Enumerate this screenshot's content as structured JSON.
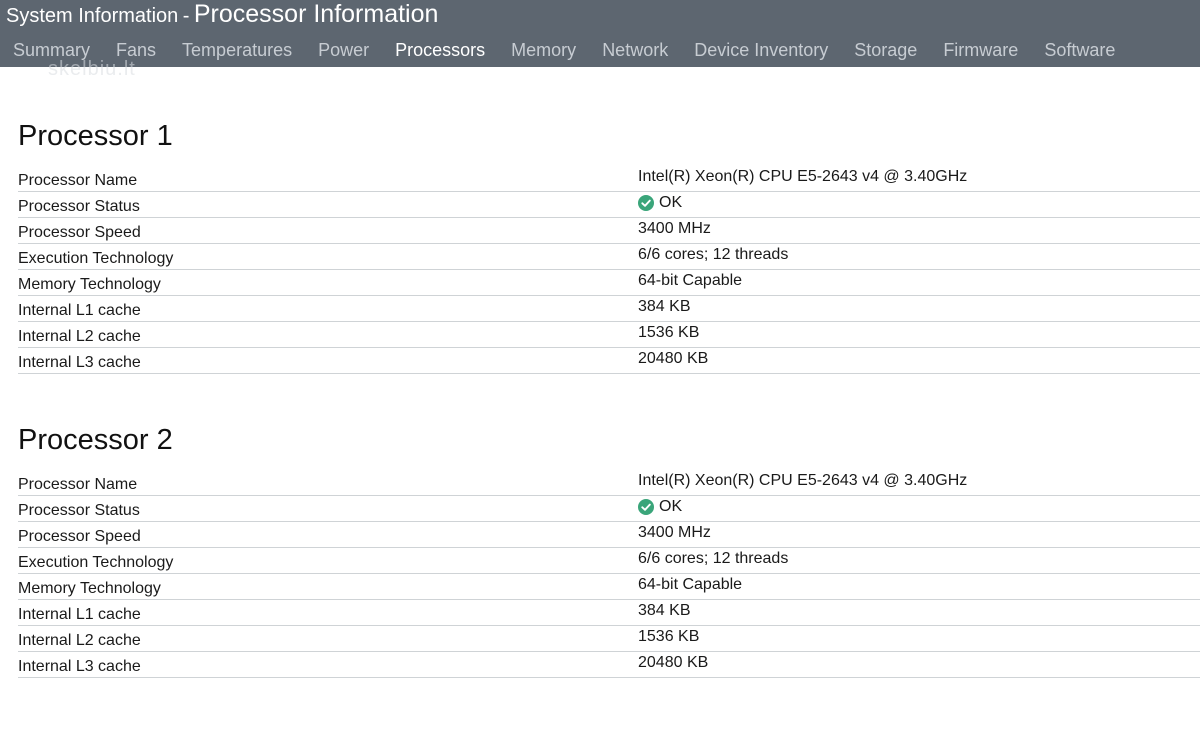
{
  "header": {
    "title_prefix": "System Information",
    "title_separator": "-",
    "title_main": "Processor Information",
    "tabs": [
      {
        "label": "Summary",
        "active": false
      },
      {
        "label": "Fans",
        "active": false
      },
      {
        "label": "Temperatures",
        "active": false
      },
      {
        "label": "Power",
        "active": false
      },
      {
        "label": "Processors",
        "active": true
      },
      {
        "label": "Memory",
        "active": false
      },
      {
        "label": "Network",
        "active": false
      },
      {
        "label": "Device Inventory",
        "active": false
      },
      {
        "label": "Storage",
        "active": false
      },
      {
        "label": "Firmware",
        "active": false
      },
      {
        "label": "Software",
        "active": false
      }
    ],
    "watermark": "skelbiu.lt"
  },
  "colors": {
    "header_bg": "#5d6670",
    "tab_inactive": "#c7ccd2",
    "tab_active": "#ffffff",
    "ok_green": "#3aa57a",
    "row_border": "#cfd3d6"
  },
  "processors": [
    {
      "title": "Processor 1",
      "rows": [
        {
          "label": "Processor Name",
          "value": "Intel(R) Xeon(R) CPU E5-2643 v4 @ 3.40GHz"
        },
        {
          "label": "Processor Status",
          "value": "OK",
          "icon": "check-circle-icon"
        },
        {
          "label": "Processor Speed",
          "value": "3400 MHz"
        },
        {
          "label": "Execution Technology",
          "value": "6/6 cores; 12 threads"
        },
        {
          "label": "Memory Technology",
          "value": "64-bit Capable"
        },
        {
          "label": "Internal L1 cache",
          "value": "384 KB"
        },
        {
          "label": "Internal L2 cache",
          "value": "1536 KB"
        },
        {
          "label": "Internal L3 cache",
          "value": "20480 KB"
        }
      ]
    },
    {
      "title": "Processor 2",
      "rows": [
        {
          "label": "Processor Name",
          "value": "Intel(R) Xeon(R) CPU E5-2643 v4 @ 3.40GHz"
        },
        {
          "label": "Processor Status",
          "value": "OK",
          "icon": "check-circle-icon"
        },
        {
          "label": "Processor Speed",
          "value": "3400 MHz"
        },
        {
          "label": "Execution Technology",
          "value": "6/6 cores; 12 threads"
        },
        {
          "label": "Memory Technology",
          "value": "64-bit Capable"
        },
        {
          "label": "Internal L1 cache",
          "value": "384 KB"
        },
        {
          "label": "Internal L2 cache",
          "value": "1536 KB"
        },
        {
          "label": "Internal L3 cache",
          "value": "20480 KB"
        }
      ]
    }
  ]
}
